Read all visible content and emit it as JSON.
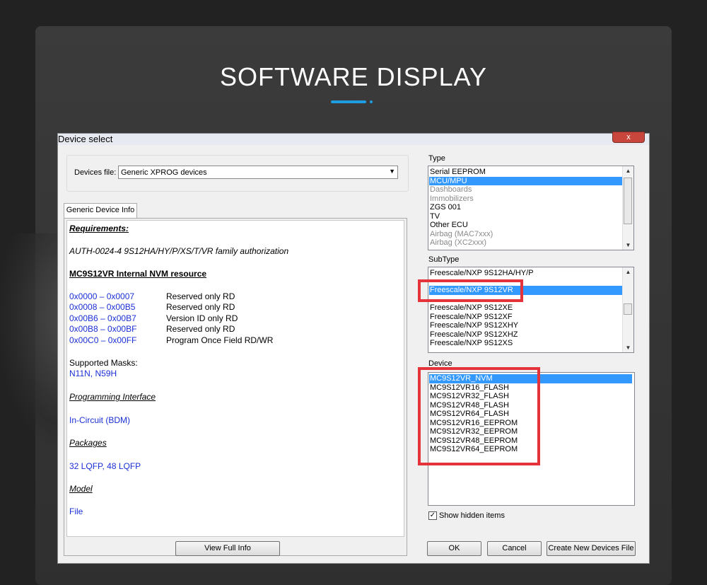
{
  "page": {
    "title": "SOFTWARE DISPLAY"
  },
  "window": {
    "title": "Device select",
    "close_label": "x",
    "devices_file": {
      "label": "Devices file:",
      "value": "Generic XPROG devices"
    },
    "tab_label": "Generic Device Info",
    "info": {
      "requirements_heading": "Requirements:",
      "auth_line": "AUTH-0024-4  9S12HA/HY/P/XS/T/VR family authorization",
      "nvm_heading": "MC9S12VR Internal NVM resource",
      "ranges": [
        {
          "range": "0x0000 – 0x0007",
          "desc": "Reserved only RD"
        },
        {
          "range": "0x0008 – 0x00B5",
          "desc": "Reserved only RD"
        },
        {
          "range": "0x00B6 – 0x00B7",
          "desc": "Version ID only RD"
        },
        {
          "range": "0x00B8 – 0x00BF",
          "desc": "Reserved only RD"
        },
        {
          "range": "0x00C0 – 0x00FF",
          "desc": "Program Once Field RD/WR"
        }
      ],
      "masks_label": "Supported Masks:",
      "masks_value": "N11N, N59H",
      "prog_heading": "Programming Interface",
      "prog_value": "In-Circuit (BDM)",
      "pkg_heading": "Packages",
      "pkg_value": "32 LQFP, 48 LQFP",
      "model_heading": "Model",
      "model_value": "File"
    },
    "view_full_info": "View Full Info",
    "type": {
      "label": "Type",
      "items": [
        "Serial EEPROM",
        "MCU/MPU",
        "Dashboards",
        "Immobilizers",
        "ZGS 001",
        "TV",
        "Other ECU",
        "Airbag (MAC7xxx)",
        "Airbag (XC2xxx)"
      ],
      "selected": "MCU/MPU"
    },
    "subtype": {
      "label": "SubType",
      "items": [
        "Freescale/NXP 9S12HA/HY/P",
        "Freescale/NXP 9S12VR",
        "Freescale/NXP 9S12XE",
        "Freescale/NXP 9S12XF",
        "Freescale/NXP 9S12XHY",
        "Freescale/NXP 9S12XHZ",
        "Freescale/NXP 9S12XS"
      ],
      "selected": "Freescale/NXP 9S12VR"
    },
    "device": {
      "label": "Device",
      "items": [
        "MC9S12VR_NVM",
        "MC9S12VR16_FLASH",
        "MC9S12VR32_FLASH",
        "MC9S12VR48_FLASH",
        "MC9S12VR64_FLASH",
        "MC9S12VR16_EEPROM",
        "MC9S12VR32_EEPROM",
        "MC9S12VR48_EEPROM",
        "MC9S12VR64_EEPROM"
      ],
      "selected": "MC9S12VR_NVM"
    },
    "show_hidden": {
      "label": "Show hidden items",
      "checked": true
    },
    "buttons": {
      "ok": "OK",
      "cancel": "Cancel",
      "create": "Create New Devices File"
    }
  },
  "colors": {
    "accent": "#1e9de3",
    "selection": "#3399ff",
    "highlight_box": "#e4333b",
    "info_link": "#1a2fd6"
  },
  "icons": {
    "scroll_up": "triangle-up-icon",
    "scroll_down": "triangle-down-icon",
    "dropdown": "triangle-down-icon",
    "check": "checkmark-icon"
  }
}
